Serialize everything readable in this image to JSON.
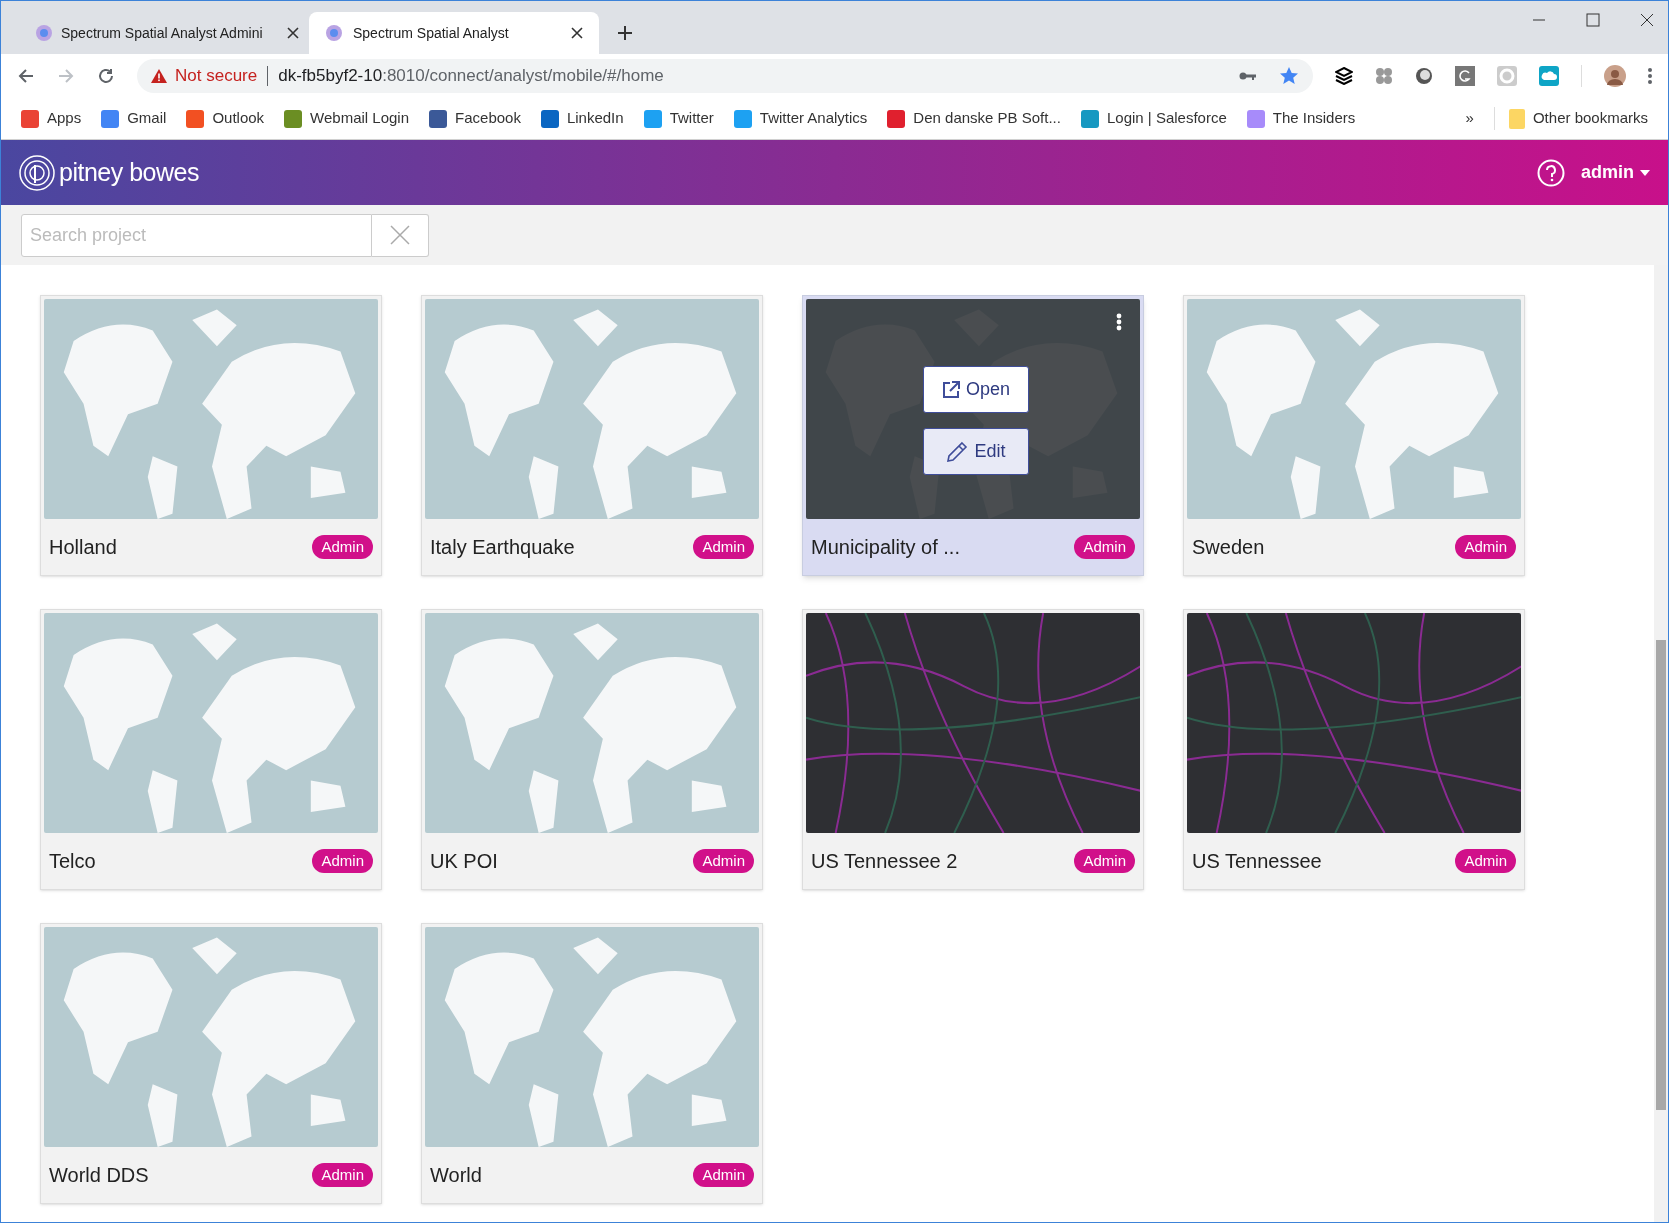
{
  "browser": {
    "tabs": [
      {
        "title": "Spectrum Spatial Analyst Admini",
        "selected": false
      },
      {
        "title": "Spectrum Spatial Analyst",
        "selected": true
      }
    ],
    "address": {
      "warning": "Not secure",
      "host": "dk-fb5byf2-10",
      "path": ":8010/connect/analyst/mobile/#/home"
    },
    "bookmarks": [
      {
        "label": "Apps",
        "color": "#ea4335"
      },
      {
        "label": "Gmail",
        "color": "#4285f4"
      },
      {
        "label": "Outlook",
        "color": "#f25022"
      },
      {
        "label": "Webmail Login",
        "color": "#6b8e23"
      },
      {
        "label": "Facebook",
        "color": "#3b5998"
      },
      {
        "label": "LinkedIn",
        "color": "#0a66c2"
      },
      {
        "label": "Twitter",
        "color": "#1da1f2"
      },
      {
        "label": "Twitter Analytics",
        "color": "#1da1f2"
      },
      {
        "label": "Den danske PB Soft...",
        "color": "#e0202e"
      },
      {
        "label": "Login | Salesforce",
        "color": "#1798c1"
      },
      {
        "label": "The Insiders",
        "color": "#a78bfa"
      }
    ],
    "bookmarks_overflow": "»",
    "other_bookmarks": "Other bookmarks"
  },
  "app": {
    "logo": "pitney bowes",
    "user": "admin",
    "search": {
      "placeholder": "Search project"
    },
    "projects": [
      {
        "name": "Holland",
        "badge": "Admin",
        "kind": "world",
        "hovered": false
      },
      {
        "name": "Italy Earthquake",
        "badge": "Admin",
        "kind": "world",
        "hovered": false
      },
      {
        "name": "Municipality of ...",
        "badge": "Admin",
        "kind": "world",
        "hovered": true
      },
      {
        "name": "Sweden",
        "badge": "Admin",
        "kind": "world",
        "hovered": false
      },
      {
        "name": "Telco",
        "badge": "Admin",
        "kind": "world",
        "hovered": false
      },
      {
        "name": "UK POI",
        "badge": "Admin",
        "kind": "world",
        "hovered": false
      },
      {
        "name": "US Tennessee 2",
        "badge": "Admin",
        "kind": "city",
        "hovered": false
      },
      {
        "name": "US Tennessee",
        "badge": "Admin",
        "kind": "city",
        "hovered": false
      },
      {
        "name": "World DDS",
        "badge": "Admin",
        "kind": "world",
        "hovered": false
      },
      {
        "name": "World",
        "badge": "Admin",
        "kind": "world",
        "hovered": false
      }
    ],
    "hover_actions": [
      {
        "label": "Open",
        "kind": "open"
      },
      {
        "label": "Edit",
        "kind": "edit"
      }
    ]
  }
}
